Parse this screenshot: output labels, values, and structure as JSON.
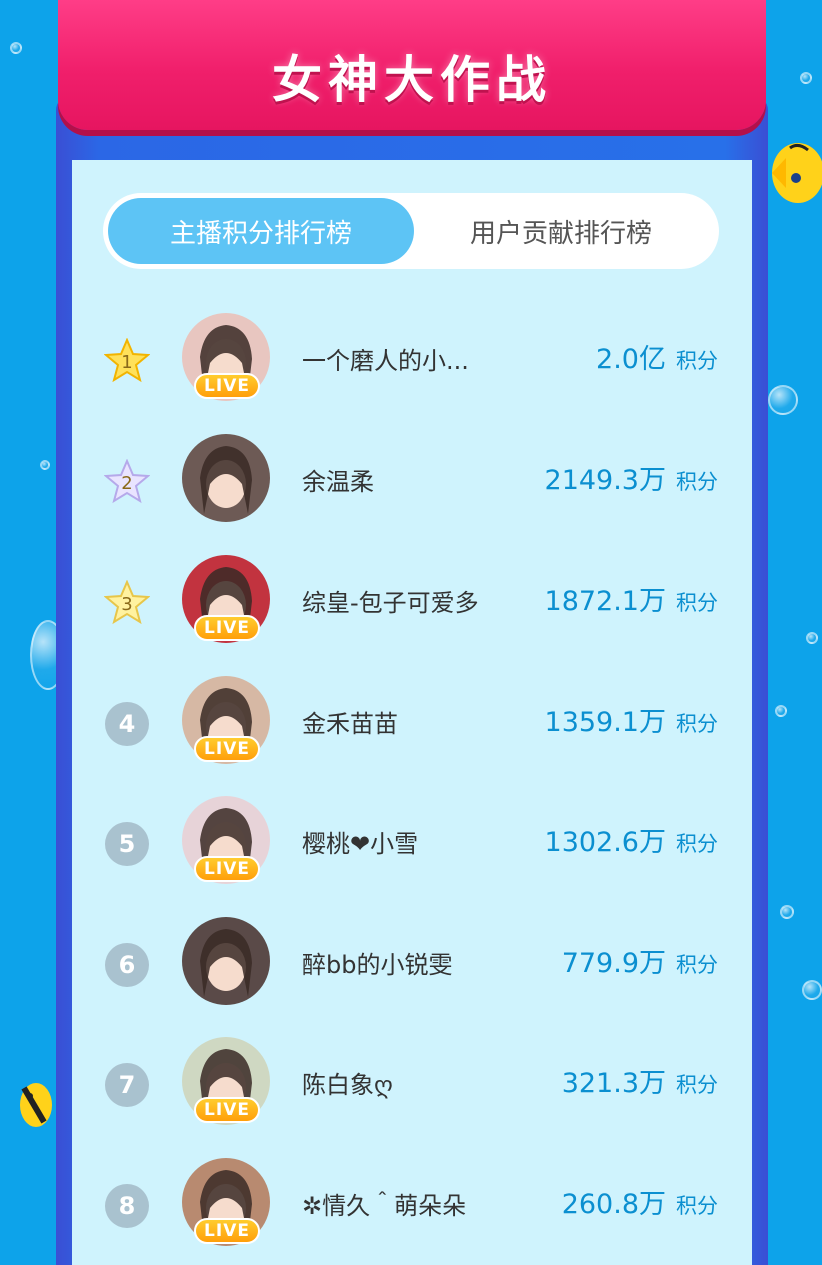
{
  "banner": {
    "title": "女神大作战"
  },
  "tabs": [
    {
      "label": "主播积分排行榜",
      "active": true
    },
    {
      "label": "用户贡献排行榜",
      "active": false
    }
  ],
  "score_unit": "积分",
  "live_badge": "LIVE",
  "colors": {
    "accent": "#0b8fd0",
    "tab_active": "#5dc4f5",
    "banner": "#f01f6b",
    "background": "#0da3ea",
    "panel": "#cff3fd"
  },
  "ranking": [
    {
      "rank": "1",
      "medal": "gold",
      "name": "一个磨人的小...",
      "score": "2.0亿",
      "live": true,
      "avatar": "#e8c6c0"
    },
    {
      "rank": "2",
      "medal": "silver",
      "name": "余温柔",
      "score": "2149.3万",
      "live": false,
      "avatar": "#6d5a55"
    },
    {
      "rank": "3",
      "medal": "bronze",
      "name": "综皇-包子可爱多",
      "score": "1872.1万",
      "live": true,
      "avatar": "#c2333f"
    },
    {
      "rank": "4",
      "medal": "none",
      "name": "金禾苗苗",
      "score": "1359.1万",
      "live": true,
      "avatar": "#d6b8a4"
    },
    {
      "rank": "5",
      "medal": "none",
      "name": "樱桃❤小雪",
      "score": "1302.6万",
      "live": true,
      "avatar": "#e7d3d8"
    },
    {
      "rank": "6",
      "medal": "none",
      "name": "醉bb的小锐雯",
      "score": "779.9万",
      "live": false,
      "avatar": "#5a4a48"
    },
    {
      "rank": "7",
      "medal": "none",
      "name": "陈白象ღ",
      "score": "321.3万",
      "live": true,
      "avatar": "#cfd8c2"
    },
    {
      "rank": "8",
      "medal": "none",
      "name": "✲情久＾萌朵朵",
      "score": "260.8万",
      "live": true,
      "avatar": "#b88a70"
    }
  ]
}
